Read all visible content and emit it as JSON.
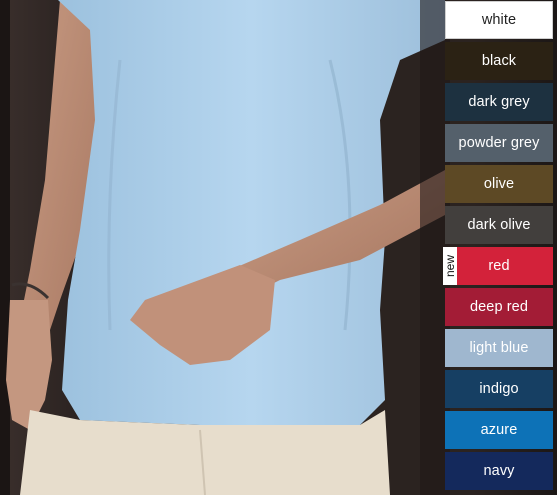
{
  "colors": [
    {
      "label": "white",
      "color": "#ffffff",
      "light": true
    },
    {
      "label": "black",
      "color": "#2b2214"
    },
    {
      "label": "dark grey",
      "color": "#1d3140"
    },
    {
      "label": "powder grey",
      "color": "#54606b"
    },
    {
      "label": "olive",
      "color": "#5d4925"
    },
    {
      "label": "dark olive",
      "color": "#423f3d"
    },
    {
      "label": "red",
      "color": "#d3223a"
    },
    {
      "label": "deep red",
      "color": "#a31c36"
    },
    {
      "label": "light blue",
      "color": "#9fb7cf"
    },
    {
      "label": "indigo",
      "color": "#163f63"
    },
    {
      "label": "azure",
      "color": "#0d72b7"
    },
    {
      "label": "navy",
      "color": "#14295c"
    }
  ],
  "new_badge": "new",
  "new_badge_on": "red"
}
